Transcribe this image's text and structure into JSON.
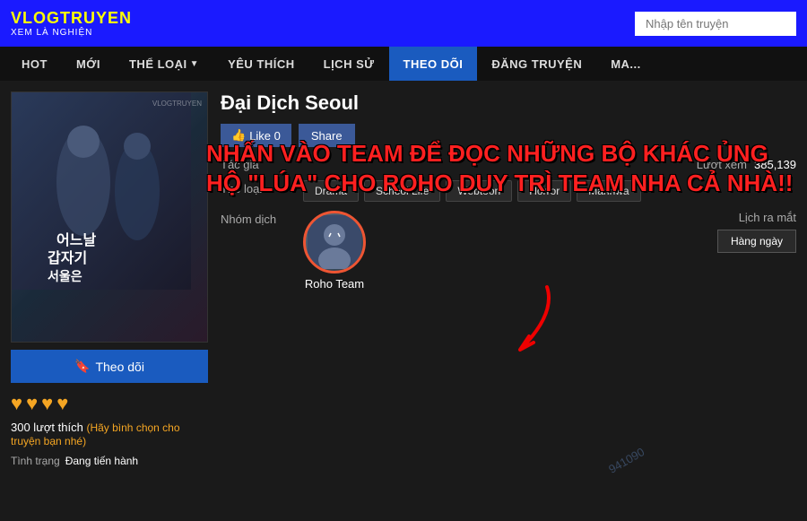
{
  "site": {
    "logo_top": "VLOGTRUYEN",
    "logo_sub": "XEM LÀ NGHIỆN",
    "search_placeholder": "Nhập tên truyện"
  },
  "nav": {
    "items": [
      {
        "label": "HOT",
        "id": "hot"
      },
      {
        "label": "MỚI",
        "id": "moi"
      },
      {
        "label": "THỂ LOẠI",
        "id": "the-loai",
        "has_arrow": true
      },
      {
        "label": "YÊU THÍCH",
        "id": "yeu-thich"
      },
      {
        "label": "LỊCH SỬ",
        "id": "lich-su"
      },
      {
        "label": "THEO DÕI",
        "id": "theo-doi",
        "active": true
      },
      {
        "label": "ĐĂNG TRUYỆN",
        "id": "dang-truyen"
      },
      {
        "label": "MA...",
        "id": "ma"
      }
    ]
  },
  "manga": {
    "title": "Đại Dịch Seoul",
    "cover_title": "어느날\n갑자기\n서울은",
    "roho_label": "ROHO\nTEAM",
    "like_label": "Like  0",
    "share_label": "Share",
    "info": {
      "author_label": "Tác giả",
      "author_value": "",
      "genre_label": "Thể loại",
      "genres": [
        "Drama",
        "School Life",
        "Webtoon",
        "Horror",
        "Manhwa"
      ],
      "team_label": "Nhóm dịch",
      "team_name": "Roho Team",
      "views_label": "Lượt xem",
      "views_value": "385,139",
      "schedule_label": "Lịch ra mắt",
      "schedule_value": "Hàng ngày"
    },
    "follow_label": "Theo dõi",
    "hearts": [
      "♥",
      "♥",
      "♥",
      "♥"
    ],
    "likes_count": "300 lượt thích",
    "likes_sub": "(Hãy bình chọn cho truyện bạn nhé)",
    "status_label": "Tình trạng",
    "status_value": "Đang tiến hành"
  },
  "overlay": {
    "line1": "NHẤN VÀO TEAM ĐỂ ĐỌC NHỮNG BỘ KHÁC ỦNG",
    "line2": "HỘ \"LÚA\" CHO ROHO DUY TRÌ TEAM NHA CẢ NHÀ!!"
  },
  "watermark": "941090"
}
